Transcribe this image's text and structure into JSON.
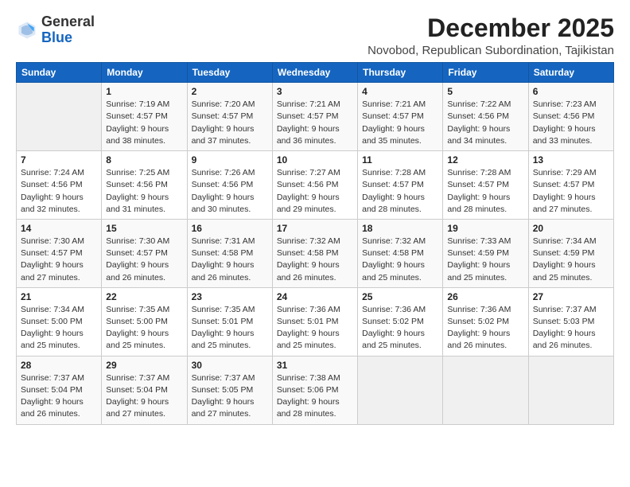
{
  "logo": {
    "general": "General",
    "blue": "Blue"
  },
  "header": {
    "month_title": "December 2025",
    "subtitle": "Novobod, Republican Subordination, Tajikistan"
  },
  "weekdays": [
    "Sunday",
    "Monday",
    "Tuesday",
    "Wednesday",
    "Thursday",
    "Friday",
    "Saturday"
  ],
  "weeks": [
    [
      {
        "day": "",
        "sunrise": "",
        "sunset": "",
        "daylight": ""
      },
      {
        "day": "1",
        "sunrise": "Sunrise: 7:19 AM",
        "sunset": "Sunset: 4:57 PM",
        "daylight": "Daylight: 9 hours and 38 minutes."
      },
      {
        "day": "2",
        "sunrise": "Sunrise: 7:20 AM",
        "sunset": "Sunset: 4:57 PM",
        "daylight": "Daylight: 9 hours and 37 minutes."
      },
      {
        "day": "3",
        "sunrise": "Sunrise: 7:21 AM",
        "sunset": "Sunset: 4:57 PM",
        "daylight": "Daylight: 9 hours and 36 minutes."
      },
      {
        "day": "4",
        "sunrise": "Sunrise: 7:21 AM",
        "sunset": "Sunset: 4:57 PM",
        "daylight": "Daylight: 9 hours and 35 minutes."
      },
      {
        "day": "5",
        "sunrise": "Sunrise: 7:22 AM",
        "sunset": "Sunset: 4:56 PM",
        "daylight": "Daylight: 9 hours and 34 minutes."
      },
      {
        "day": "6",
        "sunrise": "Sunrise: 7:23 AM",
        "sunset": "Sunset: 4:56 PM",
        "daylight": "Daylight: 9 hours and 33 minutes."
      }
    ],
    [
      {
        "day": "7",
        "sunrise": "Sunrise: 7:24 AM",
        "sunset": "Sunset: 4:56 PM",
        "daylight": "Daylight: 9 hours and 32 minutes."
      },
      {
        "day": "8",
        "sunrise": "Sunrise: 7:25 AM",
        "sunset": "Sunset: 4:56 PM",
        "daylight": "Daylight: 9 hours and 31 minutes."
      },
      {
        "day": "9",
        "sunrise": "Sunrise: 7:26 AM",
        "sunset": "Sunset: 4:56 PM",
        "daylight": "Daylight: 9 hours and 30 minutes."
      },
      {
        "day": "10",
        "sunrise": "Sunrise: 7:27 AM",
        "sunset": "Sunset: 4:56 PM",
        "daylight": "Daylight: 9 hours and 29 minutes."
      },
      {
        "day": "11",
        "sunrise": "Sunrise: 7:28 AM",
        "sunset": "Sunset: 4:57 PM",
        "daylight": "Daylight: 9 hours and 28 minutes."
      },
      {
        "day": "12",
        "sunrise": "Sunrise: 7:28 AM",
        "sunset": "Sunset: 4:57 PM",
        "daylight": "Daylight: 9 hours and 28 minutes."
      },
      {
        "day": "13",
        "sunrise": "Sunrise: 7:29 AM",
        "sunset": "Sunset: 4:57 PM",
        "daylight": "Daylight: 9 hours and 27 minutes."
      }
    ],
    [
      {
        "day": "14",
        "sunrise": "Sunrise: 7:30 AM",
        "sunset": "Sunset: 4:57 PM",
        "daylight": "Daylight: 9 hours and 27 minutes."
      },
      {
        "day": "15",
        "sunrise": "Sunrise: 7:30 AM",
        "sunset": "Sunset: 4:57 PM",
        "daylight": "Daylight: 9 hours and 26 minutes."
      },
      {
        "day": "16",
        "sunrise": "Sunrise: 7:31 AM",
        "sunset": "Sunset: 4:58 PM",
        "daylight": "Daylight: 9 hours and 26 minutes."
      },
      {
        "day": "17",
        "sunrise": "Sunrise: 7:32 AM",
        "sunset": "Sunset: 4:58 PM",
        "daylight": "Daylight: 9 hours and 26 minutes."
      },
      {
        "day": "18",
        "sunrise": "Sunrise: 7:32 AM",
        "sunset": "Sunset: 4:58 PM",
        "daylight": "Daylight: 9 hours and 25 minutes."
      },
      {
        "day": "19",
        "sunrise": "Sunrise: 7:33 AM",
        "sunset": "Sunset: 4:59 PM",
        "daylight": "Daylight: 9 hours and 25 minutes."
      },
      {
        "day": "20",
        "sunrise": "Sunrise: 7:34 AM",
        "sunset": "Sunset: 4:59 PM",
        "daylight": "Daylight: 9 hours and 25 minutes."
      }
    ],
    [
      {
        "day": "21",
        "sunrise": "Sunrise: 7:34 AM",
        "sunset": "Sunset: 5:00 PM",
        "daylight": "Daylight: 9 hours and 25 minutes."
      },
      {
        "day": "22",
        "sunrise": "Sunrise: 7:35 AM",
        "sunset": "Sunset: 5:00 PM",
        "daylight": "Daylight: 9 hours and 25 minutes."
      },
      {
        "day": "23",
        "sunrise": "Sunrise: 7:35 AM",
        "sunset": "Sunset: 5:01 PM",
        "daylight": "Daylight: 9 hours and 25 minutes."
      },
      {
        "day": "24",
        "sunrise": "Sunrise: 7:36 AM",
        "sunset": "Sunset: 5:01 PM",
        "daylight": "Daylight: 9 hours and 25 minutes."
      },
      {
        "day": "25",
        "sunrise": "Sunrise: 7:36 AM",
        "sunset": "Sunset: 5:02 PM",
        "daylight": "Daylight: 9 hours and 25 minutes."
      },
      {
        "day": "26",
        "sunrise": "Sunrise: 7:36 AM",
        "sunset": "Sunset: 5:02 PM",
        "daylight": "Daylight: 9 hours and 26 minutes."
      },
      {
        "day": "27",
        "sunrise": "Sunrise: 7:37 AM",
        "sunset": "Sunset: 5:03 PM",
        "daylight": "Daylight: 9 hours and 26 minutes."
      }
    ],
    [
      {
        "day": "28",
        "sunrise": "Sunrise: 7:37 AM",
        "sunset": "Sunset: 5:04 PM",
        "daylight": "Daylight: 9 hours and 26 minutes."
      },
      {
        "day": "29",
        "sunrise": "Sunrise: 7:37 AM",
        "sunset": "Sunset: 5:04 PM",
        "daylight": "Daylight: 9 hours and 27 minutes."
      },
      {
        "day": "30",
        "sunrise": "Sunrise: 7:37 AM",
        "sunset": "Sunset: 5:05 PM",
        "daylight": "Daylight: 9 hours and 27 minutes."
      },
      {
        "day": "31",
        "sunrise": "Sunrise: 7:38 AM",
        "sunset": "Sunset: 5:06 PM",
        "daylight": "Daylight: 9 hours and 28 minutes."
      },
      {
        "day": "",
        "sunrise": "",
        "sunset": "",
        "daylight": ""
      },
      {
        "day": "",
        "sunrise": "",
        "sunset": "",
        "daylight": ""
      },
      {
        "day": "",
        "sunrise": "",
        "sunset": "",
        "daylight": ""
      }
    ]
  ]
}
